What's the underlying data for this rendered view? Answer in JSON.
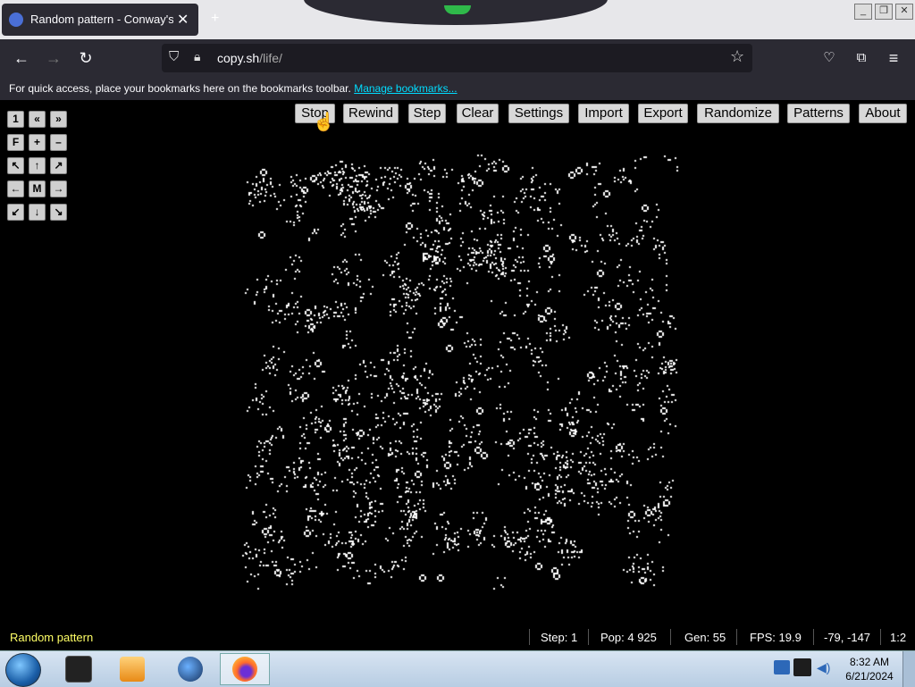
{
  "browser": {
    "tab_title": "Random pattern - Conway's Game of Life",
    "url_host": "copy.sh",
    "url_path": "/life/",
    "bookmarks_message": "For quick access, place your bookmarks here on the bookmarks toolbar.",
    "bookmarks_link": "Manage bookmarks..."
  },
  "icons": {
    "tab_favicon": "game-of-life-icon",
    "tab_close": "close-icon",
    "new_tab": "plus-icon",
    "back": "arrow-left-icon",
    "forward": "arrow-right-icon",
    "reload": "reload-icon",
    "shield": "shield-icon",
    "lock": "lock-icon",
    "bookmark_star": "star-icon",
    "pocket": "pocket-icon",
    "extensions": "puzzle-icon",
    "menu": "hamburger-icon"
  },
  "controls": [
    [
      "1",
      "«",
      "»"
    ],
    [
      "F",
      "+",
      "–"
    ],
    [
      "↖",
      "↑",
      "↗"
    ],
    [
      "←",
      "M",
      "→"
    ],
    [
      "↙",
      "↓",
      "↘"
    ]
  ],
  "menu_buttons": [
    "Stop",
    "Rewind",
    "Step",
    "Clear",
    "Settings",
    "Import",
    "Export",
    "Randomize",
    "Patterns",
    "About"
  ],
  "status": {
    "pattern_name": "Random pattern",
    "step": "Step: 1",
    "population": "Pop: 4 925",
    "generation": "Gen: 55",
    "fps": "FPS: 19.9",
    "coords": "-79, -147",
    "zoom": "1:2"
  },
  "taskbar": {
    "time": "8:32 AM",
    "date": "6/21/2024",
    "apps": [
      "terminal-icon",
      "media-player-icon",
      "globe-icon",
      "firefox-icon"
    ],
    "active_app": "firefox-icon"
  },
  "colors": {
    "background": "#000000",
    "cell": "#ffffff",
    "status_name": "#ffff66",
    "link": "#00ddff"
  }
}
